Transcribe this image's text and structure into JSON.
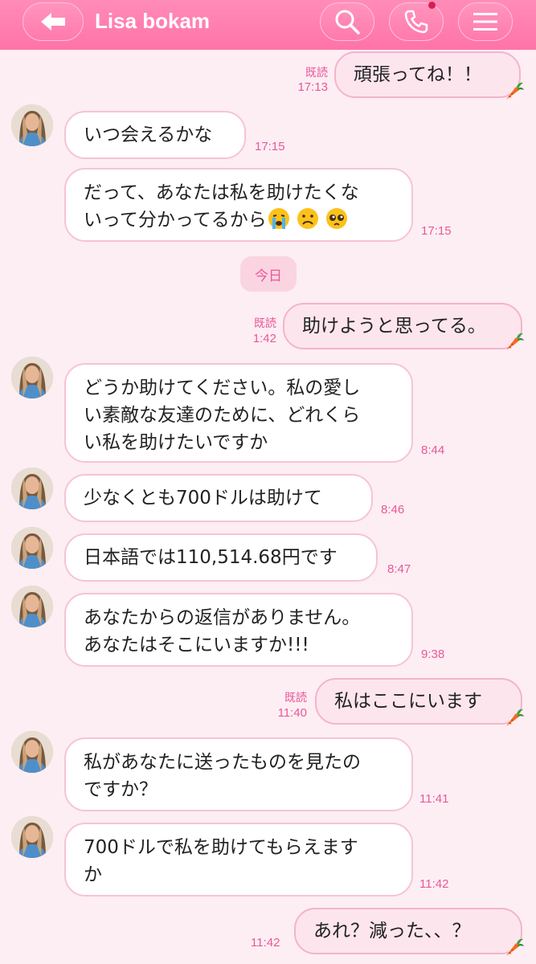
{
  "header": {
    "back_icon": "arrow-left-icon",
    "contact_name": "Lisa bokam",
    "search_icon": "magnifier-icon",
    "call_icon": "phone-icon",
    "menu_icon": "hamburger-menu-icon"
  },
  "colors": {
    "header": "#ff7aac",
    "background": "#fdeef3",
    "accent_text": "#e9579a",
    "bubble_border": "#f7c3d6"
  },
  "messages": [
    {
      "side": "out",
      "text": "頑張ってね！！",
      "read": "既読",
      "time": "17:13"
    },
    {
      "side": "in",
      "text": "いつ会えるかな",
      "time": "17:15"
    },
    {
      "side": "in",
      "text": "だって、あなたは私を助けたくな\nいって分かってるから",
      "emoji": [
        "loudly-crying-face",
        "frowning-face",
        "pleading-face"
      ],
      "time": "17:15"
    },
    {
      "side": "divider",
      "text": "今日"
    },
    {
      "side": "out",
      "text": "助けようと思ってる。",
      "read": "既読",
      "time": "1:42"
    },
    {
      "side": "in",
      "text": "どうか助けてください。私の愛し\nい素敵な友達のために、どれくら\nい私を助けたいですか",
      "time": "8:44"
    },
    {
      "side": "in",
      "text": "少なくとも700ドルは助けて",
      "time": "8:46"
    },
    {
      "side": "in",
      "text": "日本語では110,514.68円です",
      "time": "8:47"
    },
    {
      "side": "in",
      "text": "あなたからの返信がありません。\nあなたはそこにいますか!!!",
      "time": "9:38"
    },
    {
      "side": "out",
      "text": "私はここにいます",
      "read": "既読",
      "time": "11:40"
    },
    {
      "side": "in",
      "text": "私があなたに送ったものを見たの\nですか？",
      "time": "11:41"
    },
    {
      "side": "in",
      "text": "700ドルで私を助けてもらえます\nか",
      "time": "11:42"
    },
    {
      "side": "out",
      "text": "あれ？減った、、？",
      "time": "11:42"
    }
  ]
}
